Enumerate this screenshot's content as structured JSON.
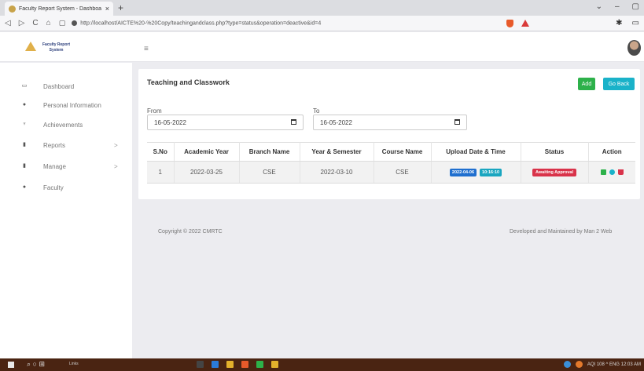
{
  "browser": {
    "tab_title": "Faculty Report System - Dashboa",
    "tab_close": "×",
    "new_tab": "+",
    "url": "http://localhost/AICTE%20-%20Copy/teachingandclass.php?type=status&operation=deactive&id=4",
    "window_controls": [
      "⌄",
      "–",
      "▢"
    ],
    "nav_icons": [
      "back-icon",
      "forward-icon",
      "reload-icon",
      "home-icon"
    ]
  },
  "header": {
    "brand_line1": "Faculty Report",
    "brand_line2": "System",
    "menu_icon": "≡"
  },
  "sidebar": {
    "items": [
      {
        "label": "Dashboard",
        "icon": "monitor-icon",
        "has_arrow": false
      },
      {
        "label": "Personal Information",
        "icon": "user-icon",
        "has_arrow": false
      },
      {
        "label": "Achievements",
        "icon": "trophy-icon",
        "has_arrow": false
      },
      {
        "label": "Reports",
        "icon": "file-icon",
        "has_arrow": true
      },
      {
        "label": "Manage",
        "icon": "file-icon",
        "has_arrow": true
      },
      {
        "label": "Faculty",
        "icon": "user-icon",
        "has_arrow": false
      }
    ],
    "arrow": ">"
  },
  "main": {
    "title": "Teaching and Classwork",
    "add_label": "Add",
    "back_label": "Go Back",
    "from_label": "From",
    "to_label": "To",
    "from_value": "16-05-2022",
    "to_value": "16-05-2022",
    "table": {
      "columns": [
        "S.No",
        "Academic Year",
        "Branch Name",
        "Year & Semester",
        "Course Name",
        "Upload Date & Time",
        "Status",
        "Action"
      ],
      "rows": [
        {
          "sno": "1",
          "academic_year": "2022-03-25",
          "branch": "CSE",
          "year_sem": "2022-03-10",
          "course": "CSE",
          "upload_date": "2022-04-06",
          "upload_time": "10:16:10",
          "status": "Awaiting Approval"
        }
      ]
    }
  },
  "footer": {
    "copyright": "Copyright © 2022 CMRTC",
    "credit": "Developed and Maintained by Man 2 Web"
  },
  "taskbar": {
    "links_label": "Links",
    "tray_text": "AQI 108  ^  ENG  12:03 AM"
  },
  "colors": {
    "add": "#2db14a",
    "back": "#1ab2c9",
    "status": "#d9334a",
    "date_badge": "#1f6fcf",
    "time_badge": "#1aa6c0"
  }
}
